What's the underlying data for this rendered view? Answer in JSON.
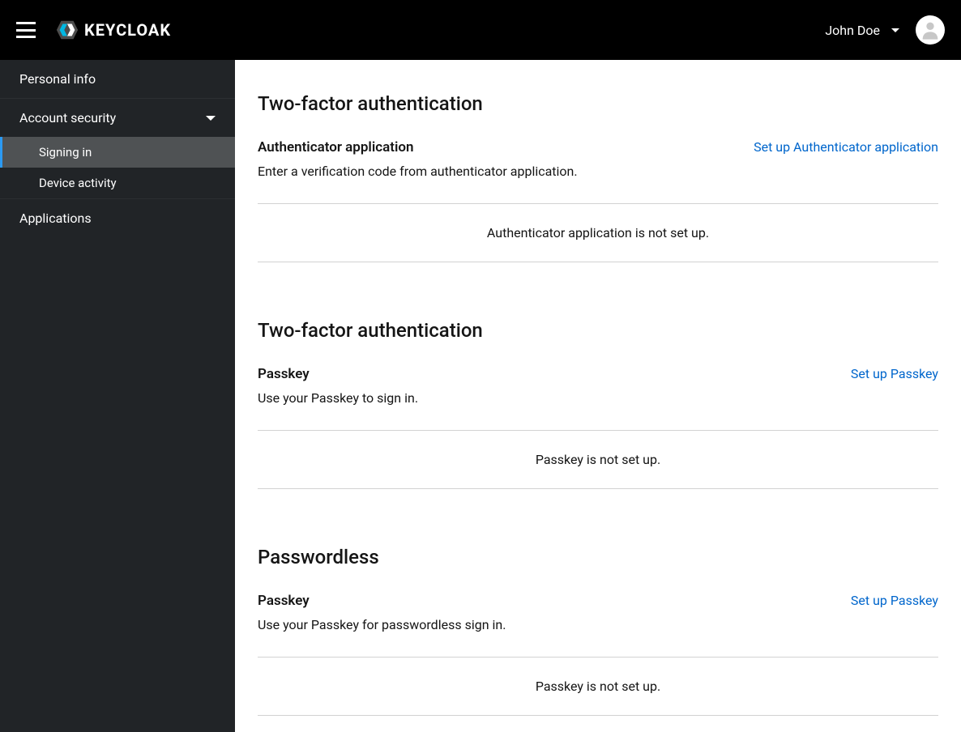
{
  "header": {
    "brand": "KEYCLOAK",
    "user_name": "John Doe"
  },
  "sidebar": {
    "items": [
      {
        "label": "Personal info",
        "type": "item"
      },
      {
        "label": "Account security",
        "type": "expandable",
        "children": [
          {
            "label": "Signing in",
            "active": true
          },
          {
            "label": "Device activity",
            "active": false
          }
        ]
      },
      {
        "label": "Applications",
        "type": "item"
      }
    ]
  },
  "sections": [
    {
      "title": "Two-factor authentication",
      "method_title": "Authenticator application",
      "method_desc": "Enter a verification code from authenticator application.",
      "setup_label": "Set up Authenticator application",
      "status": "Authenticator application is not set up."
    },
    {
      "title": "Two-factor authentication",
      "method_title": "Passkey",
      "method_desc": "Use your Passkey to sign in.",
      "setup_label": "Set up Passkey",
      "status": "Passkey is not set up."
    },
    {
      "title": "Passwordless",
      "method_title": "Passkey",
      "method_desc": "Use your Passkey for passwordless sign in.",
      "setup_label": "Set up Passkey",
      "status": "Passkey is not set up."
    }
  ]
}
